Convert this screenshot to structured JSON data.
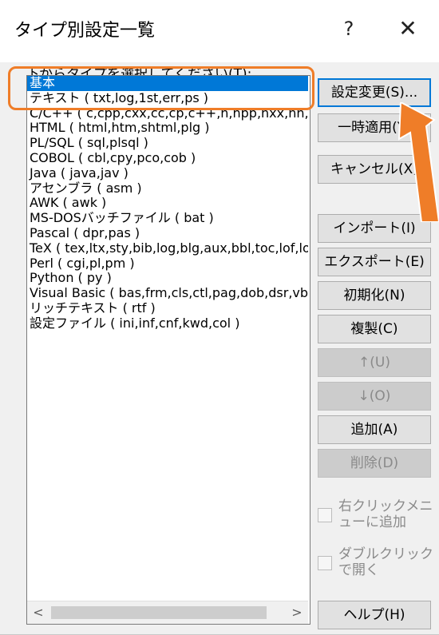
{
  "dialog": {
    "title": "タイプ別設定一覧",
    "help_label": "?",
    "close_label": "✕"
  },
  "list": {
    "prompt": "下からタイプを選択してください(T):",
    "selected_index": 0,
    "items": [
      "基本",
      "テキスト ( txt,log,1st,err,ps )",
      "C/C++ ( c,cpp,cxx,cc,cp,c++,h,hpp,hxx,hh,hp,h++,rc,hm )",
      "HTML ( html,htm,shtml,plg )",
      "PL/SQL ( sql,plsql )",
      "COBOL ( cbl,cpy,pco,cob )",
      "Java ( java,jav )",
      "アセンブラ ( asm )",
      "AWK ( awk )",
      "MS-DOSバッチファイル ( bat )",
      "Pascal ( dpr,pas )",
      "TeX ( tex,ltx,sty,bib,log,blg,aux,bbl,toc,lof,lot,idx,ind,glo )",
      "Perl ( cgi,pl,pm )",
      "Python ( py )",
      "Visual Basic ( bas,frm,cls,ctl,pag,dob,dsr,vb )",
      "リッチテキスト ( rtf )",
      "設定ファイル ( ini,inf,cnf,kwd,col )"
    ],
    "scroll_left_icon": "chevron-left",
    "scroll_right_icon": "chevron-right"
  },
  "buttons": {
    "change_settings": "設定変更(S)...",
    "temp_apply": "一時適用(Y)",
    "cancel": "キャンセル(X)",
    "import": "インポート(I)",
    "export": "エクスポート(E)",
    "initialize": "初期化(N)",
    "duplicate": "複製(C)",
    "move_up": "↑(U)",
    "move_down": "↓(O)",
    "add": "追加(A)",
    "delete": "削除(D)",
    "help": "ヘルプ(H)"
  },
  "checkboxes": {
    "right_click_menu": "右クリックメニューに追加",
    "double_click_open": "ダブルクリックで開く"
  },
  "colors": {
    "highlight_outline": "#ef7d28",
    "selection": "#0078d7",
    "pointer_arrow": "#ef7d28"
  }
}
